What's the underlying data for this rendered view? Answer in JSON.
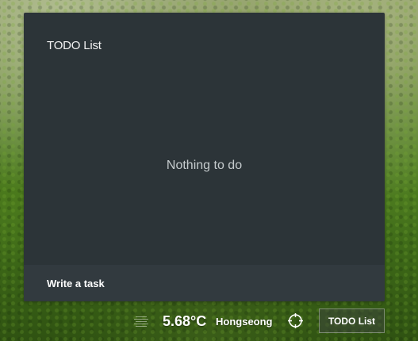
{
  "todo_panel": {
    "title": "TODO List",
    "empty_message": "Nothing to do",
    "input_placeholder": "Write a task"
  },
  "status_bar": {
    "menu_icon": "hamburger-lines-icon",
    "temperature": "5.68°C",
    "city": "Hongseong",
    "location_icon": "crosshair-icon",
    "todo_button_label": "TODO List"
  },
  "colors": {
    "panel_bg": "#2c3438",
    "input_bg": "#323a3f",
    "text_light": "#f2f2f2",
    "text_muted": "#c5cbcd"
  }
}
